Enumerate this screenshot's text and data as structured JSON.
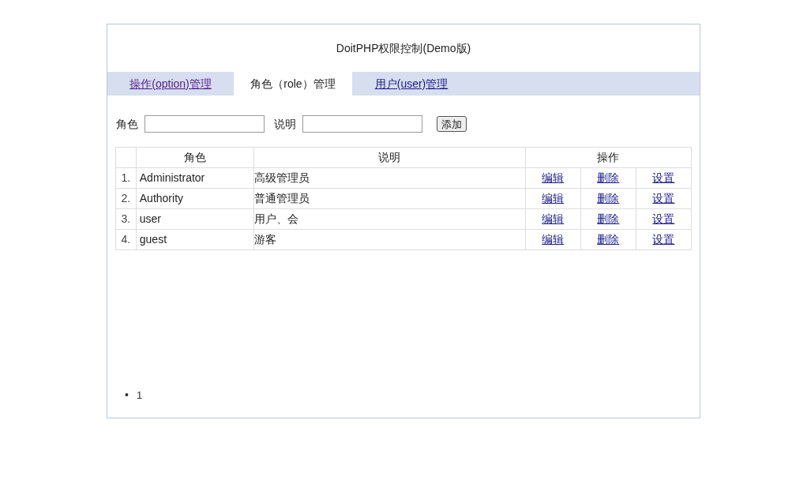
{
  "title": "DoitPHP权限控制(Demo版)",
  "tabs": [
    {
      "label": "操作(option)管理",
      "selected": false,
      "visited": true
    },
    {
      "label": "角色（role）管理",
      "selected": true,
      "visited": false
    },
    {
      "label": "用户(user)管理",
      "selected": false,
      "visited": false
    }
  ],
  "form": {
    "fields": [
      {
        "label": "角色"
      },
      {
        "label": "说明"
      }
    ],
    "button": "添加"
  },
  "table": {
    "columns": [
      "角色",
      "说明",
      "操作"
    ],
    "rows": [
      {
        "index": "1.",
        "role": "Administrator",
        "description": "高级管理员",
        "actions": [
          "编辑",
          "删除",
          "设置"
        ]
      },
      {
        "index": "2.",
        "role": "Authority",
        "description": "普通管理员",
        "actions": [
          "编辑",
          "删除",
          "设置"
        ]
      },
      {
        "index": "3.",
        "role": "user",
        "description": "用户、会",
        "actions": [
          "编辑",
          "删除",
          "设置"
        ]
      },
      {
        "index": "4.",
        "role": "guest",
        "description": "游客",
        "actions": [
          "编辑",
          "删除",
          "设置"
        ]
      }
    ]
  },
  "pagination": [
    {
      "marker": "•",
      "label": "1"
    }
  ]
}
